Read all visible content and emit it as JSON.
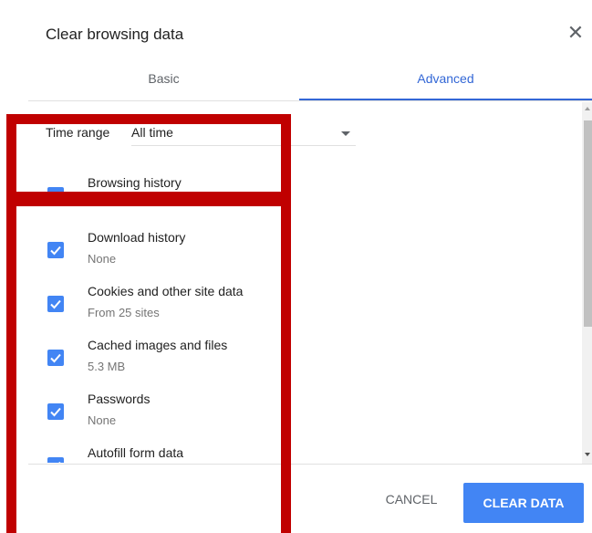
{
  "dialog": {
    "title": "Clear browsing data",
    "close_icon": "close-icon"
  },
  "tabs": [
    {
      "label": "Basic",
      "active": false
    },
    {
      "label": "Advanced",
      "active": true
    }
  ],
  "time_range": {
    "label": "Time range",
    "value": "All time"
  },
  "items": [
    {
      "label": "Browsing history",
      "sub": "",
      "checked": true
    },
    {
      "label": "Download history",
      "sub": "None",
      "checked": true
    },
    {
      "label": "Cookies and other site data",
      "sub": "From 25 sites",
      "checked": true
    },
    {
      "label": "Cached images and files",
      "sub": "5.3 MB",
      "checked": true
    },
    {
      "label": "Passwords",
      "sub": "None",
      "checked": true
    },
    {
      "label": "Autofill form data",
      "sub": "",
      "checked": true
    }
  ],
  "footer": {
    "cancel_label": "CANCEL",
    "clear_label": "CLEAR DATA"
  },
  "colors": {
    "accent": "#4285f4",
    "tab_active": "#3367d6",
    "highlight": "#c00000"
  }
}
